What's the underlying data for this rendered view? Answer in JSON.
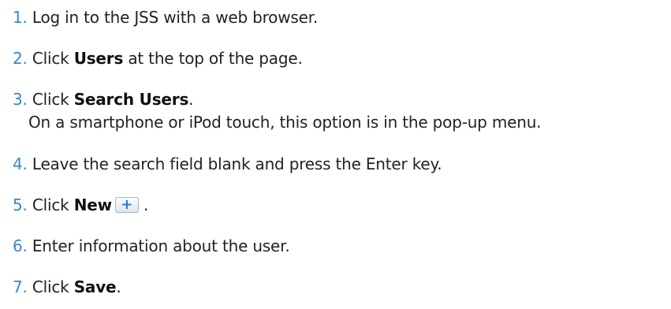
{
  "steps": [
    {
      "num": "1.",
      "before": "Log in to the JSS with a web browser.",
      "bold": "",
      "after": ""
    },
    {
      "num": "2.",
      "before": "Click ",
      "bold": "Users",
      "after": " at the top of the page."
    },
    {
      "num": "3.",
      "before": "Click ",
      "bold": "Search Users",
      "after": ".",
      "note": "On a smartphone or iPod touch, this option is in the pop-up menu."
    },
    {
      "num": "4.",
      "before": "Leave the search field blank and press the Enter key.",
      "bold": "",
      "after": ""
    },
    {
      "num": "5.",
      "before": "Click ",
      "bold": "New",
      "after": " .",
      "icon": "plus-icon",
      "icon_glyph": "+"
    },
    {
      "num": "6.",
      "before": "Enter information about the user.",
      "bold": "",
      "after": ""
    },
    {
      "num": "7.",
      "before": "Click ",
      "bold": "Save",
      "after": "."
    }
  ],
  "colors": {
    "step_number": "#3a86c8",
    "text": "#222222",
    "button_icon": "#2f7ac6"
  }
}
